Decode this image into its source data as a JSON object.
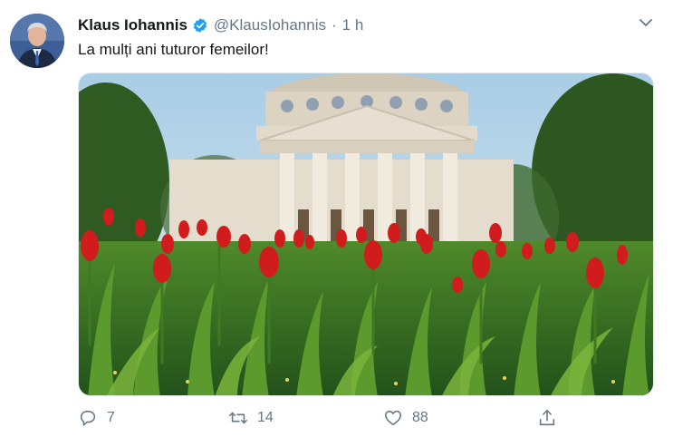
{
  "tweet": {
    "author_name": "Klaus Iohannis",
    "handle": "@KlausIohannis",
    "separator": "·",
    "time": "1 h",
    "verified": true,
    "text": "La mulți ani tuturor femeilor!",
    "photo_subject": "red-tulips-ateneul-roman",
    "actions": {
      "replies": "7",
      "retweets": "14",
      "likes": "88"
    }
  },
  "colors": {
    "verified_blue": "#1da1f2",
    "muted": "#657786",
    "text": "#14171a",
    "tulip_red": "#d01c1c"
  },
  "icons": {
    "menu": "chevron-down-icon",
    "reply": "reply-icon",
    "retweet": "retweet-icon",
    "like": "heart-icon",
    "share": "share-icon"
  }
}
